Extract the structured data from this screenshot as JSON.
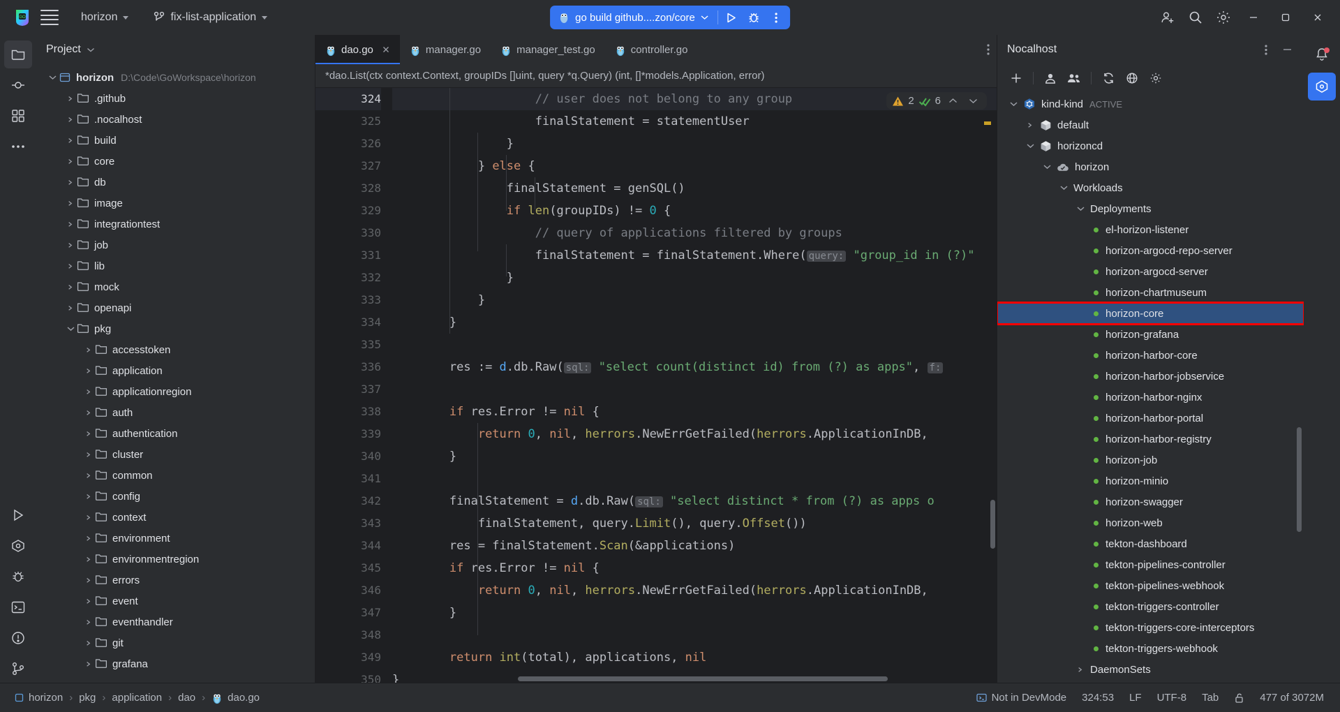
{
  "titlebar": {
    "logo_icon": "goland-logo-icon",
    "menu_icon": "hamburger-menu-icon",
    "project_name": "horizon",
    "branch_icon": "vcs-branch-icon",
    "branch_name": "fix-list-application",
    "run_config": {
      "icon": "go-gopher-icon",
      "label": "go build github....zon/core",
      "run_icon": "run-play-icon",
      "debug_icon": "debug-bug-icon",
      "more_icon": "more-vertical-icon",
      "accent": "#3574f0"
    },
    "actions": [
      {
        "name": "add-user-icon"
      },
      {
        "name": "search-icon"
      },
      {
        "name": "settings-gear-icon"
      }
    ],
    "window_controls": [
      "minimize-icon",
      "maximize-icon",
      "close-icon"
    ]
  },
  "left_rail": [
    {
      "name": "project-tool-icon",
      "active": true
    },
    {
      "name": "commit-tool-icon",
      "active": false
    },
    {
      "name": "structure-tool-icon",
      "active": false
    },
    {
      "name": "more-tools-icon",
      "active": false
    },
    {
      "name": "run-tool-icon",
      "active": false
    },
    {
      "name": "nocalhost-tool-icon",
      "active": false
    },
    {
      "name": "debug-tool-icon",
      "active": false
    },
    {
      "name": "terminal-tool-icon",
      "active": false
    },
    {
      "name": "problems-tool-icon",
      "active": false
    },
    {
      "name": "version-control-tool-icon",
      "active": false
    }
  ],
  "project_panel": {
    "title": "Project",
    "title_caret": "chevron-down-icon",
    "root": {
      "label": "horizon",
      "path": "D:\\Code\\GoWorkspace\\horizon",
      "expanded": true
    },
    "items": [
      {
        "label": ".github",
        "depth": 1,
        "expanded": false
      },
      {
        "label": ".nocalhost",
        "depth": 1,
        "expanded": false
      },
      {
        "label": "build",
        "depth": 1,
        "expanded": false
      },
      {
        "label": "core",
        "depth": 1,
        "expanded": false
      },
      {
        "label": "db",
        "depth": 1,
        "expanded": false
      },
      {
        "label": "image",
        "depth": 1,
        "expanded": false
      },
      {
        "label": "integrationtest",
        "depth": 1,
        "expanded": false
      },
      {
        "label": "job",
        "depth": 1,
        "expanded": false
      },
      {
        "label": "lib",
        "depth": 1,
        "expanded": false
      },
      {
        "label": "mock",
        "depth": 1,
        "expanded": false
      },
      {
        "label": "openapi",
        "depth": 1,
        "expanded": false
      },
      {
        "label": "pkg",
        "depth": 1,
        "expanded": true
      },
      {
        "label": "accesstoken",
        "depth": 2,
        "expanded": false
      },
      {
        "label": "application",
        "depth": 2,
        "expanded": false
      },
      {
        "label": "applicationregion",
        "depth": 2,
        "expanded": false
      },
      {
        "label": "auth",
        "depth": 2,
        "expanded": false
      },
      {
        "label": "authentication",
        "depth": 2,
        "expanded": false
      },
      {
        "label": "cluster",
        "depth": 2,
        "expanded": false
      },
      {
        "label": "common",
        "depth": 2,
        "expanded": false
      },
      {
        "label": "config",
        "depth": 2,
        "expanded": false
      },
      {
        "label": "context",
        "depth": 2,
        "expanded": false
      },
      {
        "label": "environment",
        "depth": 2,
        "expanded": false
      },
      {
        "label": "environmentregion",
        "depth": 2,
        "expanded": false
      },
      {
        "label": "errors",
        "depth": 2,
        "expanded": false
      },
      {
        "label": "event",
        "depth": 2,
        "expanded": false
      },
      {
        "label": "eventhandler",
        "depth": 2,
        "expanded": false
      },
      {
        "label": "git",
        "depth": 2,
        "expanded": false
      },
      {
        "label": "grafana",
        "depth": 2,
        "expanded": false
      }
    ]
  },
  "editor": {
    "tabs": [
      {
        "label": "dao.go",
        "active": true,
        "closable": true
      },
      {
        "label": "manager.go",
        "active": false,
        "closable": false
      },
      {
        "label": "manager_test.go",
        "active": false,
        "closable": false
      },
      {
        "label": "controller.go",
        "active": false,
        "closable": false
      }
    ],
    "tab_options_icon": "more-vertical-icon",
    "breadcrumb": "*dao.List(ctx context.Context, groupIDs []uint, query *q.Query) (int, []*models.Application, error)",
    "inspection_widget": {
      "warning_icon": "warning-triangle-icon",
      "warning_count": "2",
      "ok_icon": "inspection-ok-icon",
      "ok_count": "6",
      "prev_icon": "chevron-up-icon",
      "next_icon": "chevron-down-icon"
    },
    "first_line": 324,
    "current_line": 324,
    "lines": [
      {
        "n": 324,
        "indent": 5,
        "tokens": [
          {
            "t": "// user does not belong to any group",
            "c": "cmt"
          }
        ]
      },
      {
        "n": 325,
        "indent": 5,
        "tokens": [
          {
            "t": "finalStatement ",
            "c": "id"
          },
          {
            "t": "= ",
            "c": "id"
          },
          {
            "t": "statementUser",
            "c": "id"
          }
        ]
      },
      {
        "n": 326,
        "indent": 4,
        "tokens": [
          {
            "t": "}",
            "c": "id"
          }
        ]
      },
      {
        "n": 327,
        "indent": 3,
        "tokens": [
          {
            "t": "} ",
            "c": "id"
          },
          {
            "t": "else",
            "c": "kw"
          },
          {
            "t": " {",
            "c": "id"
          }
        ]
      },
      {
        "n": 328,
        "indent": 4,
        "tokens": [
          {
            "t": "finalStatement = ",
            "c": "id"
          },
          {
            "t": "genSQL",
            "c": "id"
          },
          {
            "t": "()",
            "c": "id"
          }
        ]
      },
      {
        "n": 329,
        "indent": 4,
        "tokens": [
          {
            "t": "if ",
            "c": "kw"
          },
          {
            "t": "len",
            "c": "typ"
          },
          {
            "t": "(groupIDs) != ",
            "c": "id"
          },
          {
            "t": "0",
            "c": "num"
          },
          {
            "t": " {",
            "c": "id"
          }
        ]
      },
      {
        "n": 330,
        "indent": 5,
        "tokens": [
          {
            "t": "// query of applications filtered by groups",
            "c": "cmt"
          }
        ]
      },
      {
        "n": 331,
        "indent": 5,
        "tokens": [
          {
            "t": "finalStatement = finalStatement.",
            "c": "id"
          },
          {
            "t": "Where",
            "c": "id"
          },
          {
            "t": "(",
            "c": "id"
          },
          {
            "t": "query:",
            "c": "param"
          },
          {
            "t": " ",
            "c": "id"
          },
          {
            "t": "\"group_id in (?)\"",
            "c": "str"
          }
        ]
      },
      {
        "n": 332,
        "indent": 4,
        "tokens": [
          {
            "t": "}",
            "c": "id"
          }
        ]
      },
      {
        "n": 333,
        "indent": 3,
        "tokens": [
          {
            "t": "}",
            "c": "id"
          }
        ]
      },
      {
        "n": 334,
        "indent": 2,
        "tokens": [
          {
            "t": "}",
            "c": "id"
          }
        ]
      },
      {
        "n": 335,
        "indent": 0,
        "tokens": []
      },
      {
        "n": 336,
        "indent": 2,
        "tokens": [
          {
            "t": "res := ",
            "c": "id"
          },
          {
            "t": "d",
            "c": "fn"
          },
          {
            "t": ".db.",
            "c": "id"
          },
          {
            "t": "Raw",
            "c": "id"
          },
          {
            "t": "(",
            "c": "id"
          },
          {
            "t": "sql:",
            "c": "param"
          },
          {
            "t": " ",
            "c": "id"
          },
          {
            "t": "\"select count(distinct id) from (?) as apps\"",
            "c": "str"
          },
          {
            "t": ", ",
            "c": "id"
          },
          {
            "t": "f:",
            "c": "param"
          }
        ]
      },
      {
        "n": 337,
        "indent": 0,
        "tokens": []
      },
      {
        "n": 338,
        "indent": 2,
        "tokens": [
          {
            "t": "if ",
            "c": "kw"
          },
          {
            "t": "res.Error != ",
            "c": "id"
          },
          {
            "t": "nil",
            "c": "kw"
          },
          {
            "t": " {",
            "c": "id"
          }
        ]
      },
      {
        "n": 339,
        "indent": 3,
        "tokens": [
          {
            "t": "return ",
            "c": "kw"
          },
          {
            "t": "0",
            "c": "num"
          },
          {
            "t": ", ",
            "c": "id"
          },
          {
            "t": "nil",
            "c": "kw"
          },
          {
            "t": ", ",
            "c": "id"
          },
          {
            "t": "herrors",
            "c": "typ"
          },
          {
            "t": ".",
            "c": "id"
          },
          {
            "t": "NewErrGetFailed",
            "c": "id"
          },
          {
            "t": "(",
            "c": "id"
          },
          {
            "t": "herrors",
            "c": "typ"
          },
          {
            "t": ".ApplicationInDB,",
            "c": "id"
          }
        ]
      },
      {
        "n": 340,
        "indent": 2,
        "tokens": [
          {
            "t": "}",
            "c": "id"
          }
        ]
      },
      {
        "n": 341,
        "indent": 0,
        "tokens": []
      },
      {
        "n": 342,
        "indent": 2,
        "tokens": [
          {
            "t": "finalStatement = ",
            "c": "id"
          },
          {
            "t": "d",
            "c": "fn"
          },
          {
            "t": ".db.",
            "c": "id"
          },
          {
            "t": "Raw",
            "c": "id"
          },
          {
            "t": "(",
            "c": "id"
          },
          {
            "t": "sql:",
            "c": "param"
          },
          {
            "t": " ",
            "c": "id"
          },
          {
            "t": "\"select distinct * from (?) as apps o",
            "c": "str"
          }
        ]
      },
      {
        "n": 343,
        "indent": 3,
        "tokens": [
          {
            "t": "finalStatement",
            "c": "id"
          },
          {
            "t": ", ",
            "c": "id"
          },
          {
            "t": "query.",
            "c": "id"
          },
          {
            "t": "Limit",
            "c": "typ"
          },
          {
            "t": "()",
            "c": "id"
          },
          {
            "t": ", ",
            "c": "id"
          },
          {
            "t": "query.",
            "c": "id"
          },
          {
            "t": "Offset",
            "c": "typ"
          },
          {
            "t": "())",
            "c": "id"
          }
        ]
      },
      {
        "n": 344,
        "indent": 2,
        "tokens": [
          {
            "t": "res = finalStatement.",
            "c": "id"
          },
          {
            "t": "Scan",
            "c": "typ"
          },
          {
            "t": "(&applications)",
            "c": "id"
          }
        ]
      },
      {
        "n": 345,
        "indent": 2,
        "tokens": [
          {
            "t": "if ",
            "c": "kw"
          },
          {
            "t": "res.Error != ",
            "c": "id"
          },
          {
            "t": "nil",
            "c": "kw"
          },
          {
            "t": " {",
            "c": "id"
          }
        ]
      },
      {
        "n": 346,
        "indent": 3,
        "tokens": [
          {
            "t": "return ",
            "c": "kw"
          },
          {
            "t": "0",
            "c": "num"
          },
          {
            "t": ", ",
            "c": "id"
          },
          {
            "t": "nil",
            "c": "kw"
          },
          {
            "t": ", ",
            "c": "id"
          },
          {
            "t": "herrors",
            "c": "typ"
          },
          {
            "t": ".",
            "c": "id"
          },
          {
            "t": "NewErrGetFailed",
            "c": "id"
          },
          {
            "t": "(",
            "c": "id"
          },
          {
            "t": "herrors",
            "c": "typ"
          },
          {
            "t": ".ApplicationInDB,",
            "c": "id"
          }
        ]
      },
      {
        "n": 347,
        "indent": 2,
        "tokens": [
          {
            "t": "}",
            "c": "id"
          }
        ]
      },
      {
        "n": 348,
        "indent": 0,
        "tokens": []
      },
      {
        "n": 349,
        "indent": 2,
        "tokens": [
          {
            "t": "return ",
            "c": "kw"
          },
          {
            "t": "int",
            "c": "typ"
          },
          {
            "t": "(total), applications, ",
            "c": "id"
          },
          {
            "t": "nil",
            "c": "kw"
          }
        ]
      },
      {
        "n": 350,
        "indent": 0,
        "tokens": [
          {
            "t": "}",
            "c": "id"
          }
        ]
      }
    ]
  },
  "nocalhost": {
    "title": "Nocalhost",
    "header_icons": [
      "more-vertical-icon",
      "minimize-panel-icon"
    ],
    "toolbar_icons": [
      {
        "name": "add-cluster-icon"
      },
      {
        "name": "user-icon"
      },
      {
        "name": "users-group-icon"
      },
      {
        "name": "refresh-icon"
      },
      {
        "name": "globe-icon"
      },
      {
        "name": "settings-gear-icon"
      }
    ],
    "tree": {
      "cluster": {
        "label": "kind-kind",
        "badge": "ACTIVE",
        "icon": "kubernetes-icon",
        "expanded": true
      },
      "namespaces": [
        {
          "label": "default",
          "icon": "cube-icon",
          "expanded": false
        },
        {
          "label": "horizoncd",
          "icon": "cube-icon",
          "expanded": true
        }
      ],
      "app": {
        "label": "horizon",
        "icon": "cloud-check-icon",
        "expanded": true
      },
      "group": {
        "label": "Workloads",
        "expanded": true
      },
      "kind": {
        "label": "Deployments",
        "expanded": true
      },
      "deployments": [
        {
          "label": "el-horizon-listener",
          "status": "#62b543"
        },
        {
          "label": "horizon-argocd-repo-server",
          "status": "#62b543"
        },
        {
          "label": "horizon-argocd-server",
          "status": "#62b543"
        },
        {
          "label": "horizon-chartmuseum",
          "status": "#62b543"
        },
        {
          "label": "horizon-core",
          "status": "#62b543",
          "selected": true,
          "highlight_box": "#fa0000"
        },
        {
          "label": "horizon-grafana",
          "status": "#62b543"
        },
        {
          "label": "horizon-harbor-core",
          "status": "#62b543"
        },
        {
          "label": "horizon-harbor-jobservice",
          "status": "#62b543"
        },
        {
          "label": "horizon-harbor-nginx",
          "status": "#62b543"
        },
        {
          "label": "horizon-harbor-portal",
          "status": "#62b543"
        },
        {
          "label": "horizon-harbor-registry",
          "status": "#62b543"
        },
        {
          "label": "horizon-job",
          "status": "#62b543"
        },
        {
          "label": "horizon-minio",
          "status": "#62b543"
        },
        {
          "label": "horizon-swagger",
          "status": "#62b543"
        },
        {
          "label": "horizon-web",
          "status": "#62b543"
        },
        {
          "label": "tekton-dashboard",
          "status": "#62b543"
        },
        {
          "label": "tekton-pipelines-controller",
          "status": "#62b543"
        },
        {
          "label": "tekton-pipelines-webhook",
          "status": "#62b543"
        },
        {
          "label": "tekton-triggers-controller",
          "status": "#62b543"
        },
        {
          "label": "tekton-triggers-core-interceptors",
          "status": "#62b543"
        },
        {
          "label": "tekton-triggers-webhook",
          "status": "#62b543"
        }
      ],
      "next_kind": {
        "label": "DaemonSets",
        "expanded": false
      }
    }
  },
  "right_rail": [
    {
      "name": "notifications-bell-icon"
    },
    {
      "name": "nocalhost-panel-icon",
      "active": true
    }
  ],
  "statusbar": {
    "breadcrumbs": [
      {
        "label": "horizon",
        "icon": "module-icon"
      },
      {
        "label": "pkg",
        "icon": null
      },
      {
        "label": "application",
        "icon": null
      },
      {
        "label": "dao",
        "icon": null
      },
      {
        "label": "dao.go",
        "icon": "go-file-icon"
      }
    ],
    "separator": "›",
    "right": [
      {
        "name": "devmode-status",
        "label": "Not in DevMode",
        "icon": "devmode-icon"
      },
      {
        "name": "caret-position",
        "label": "324:53"
      },
      {
        "name": "line-separator",
        "label": "LF"
      },
      {
        "name": "file-encoding",
        "label": "UTF-8"
      },
      {
        "name": "indent-setting",
        "label": "Tab"
      },
      {
        "name": "readonly-toggle",
        "label": "",
        "icon": "lock-open-icon"
      },
      {
        "name": "memory-indicator",
        "label": "477 of 3072M"
      }
    ]
  }
}
